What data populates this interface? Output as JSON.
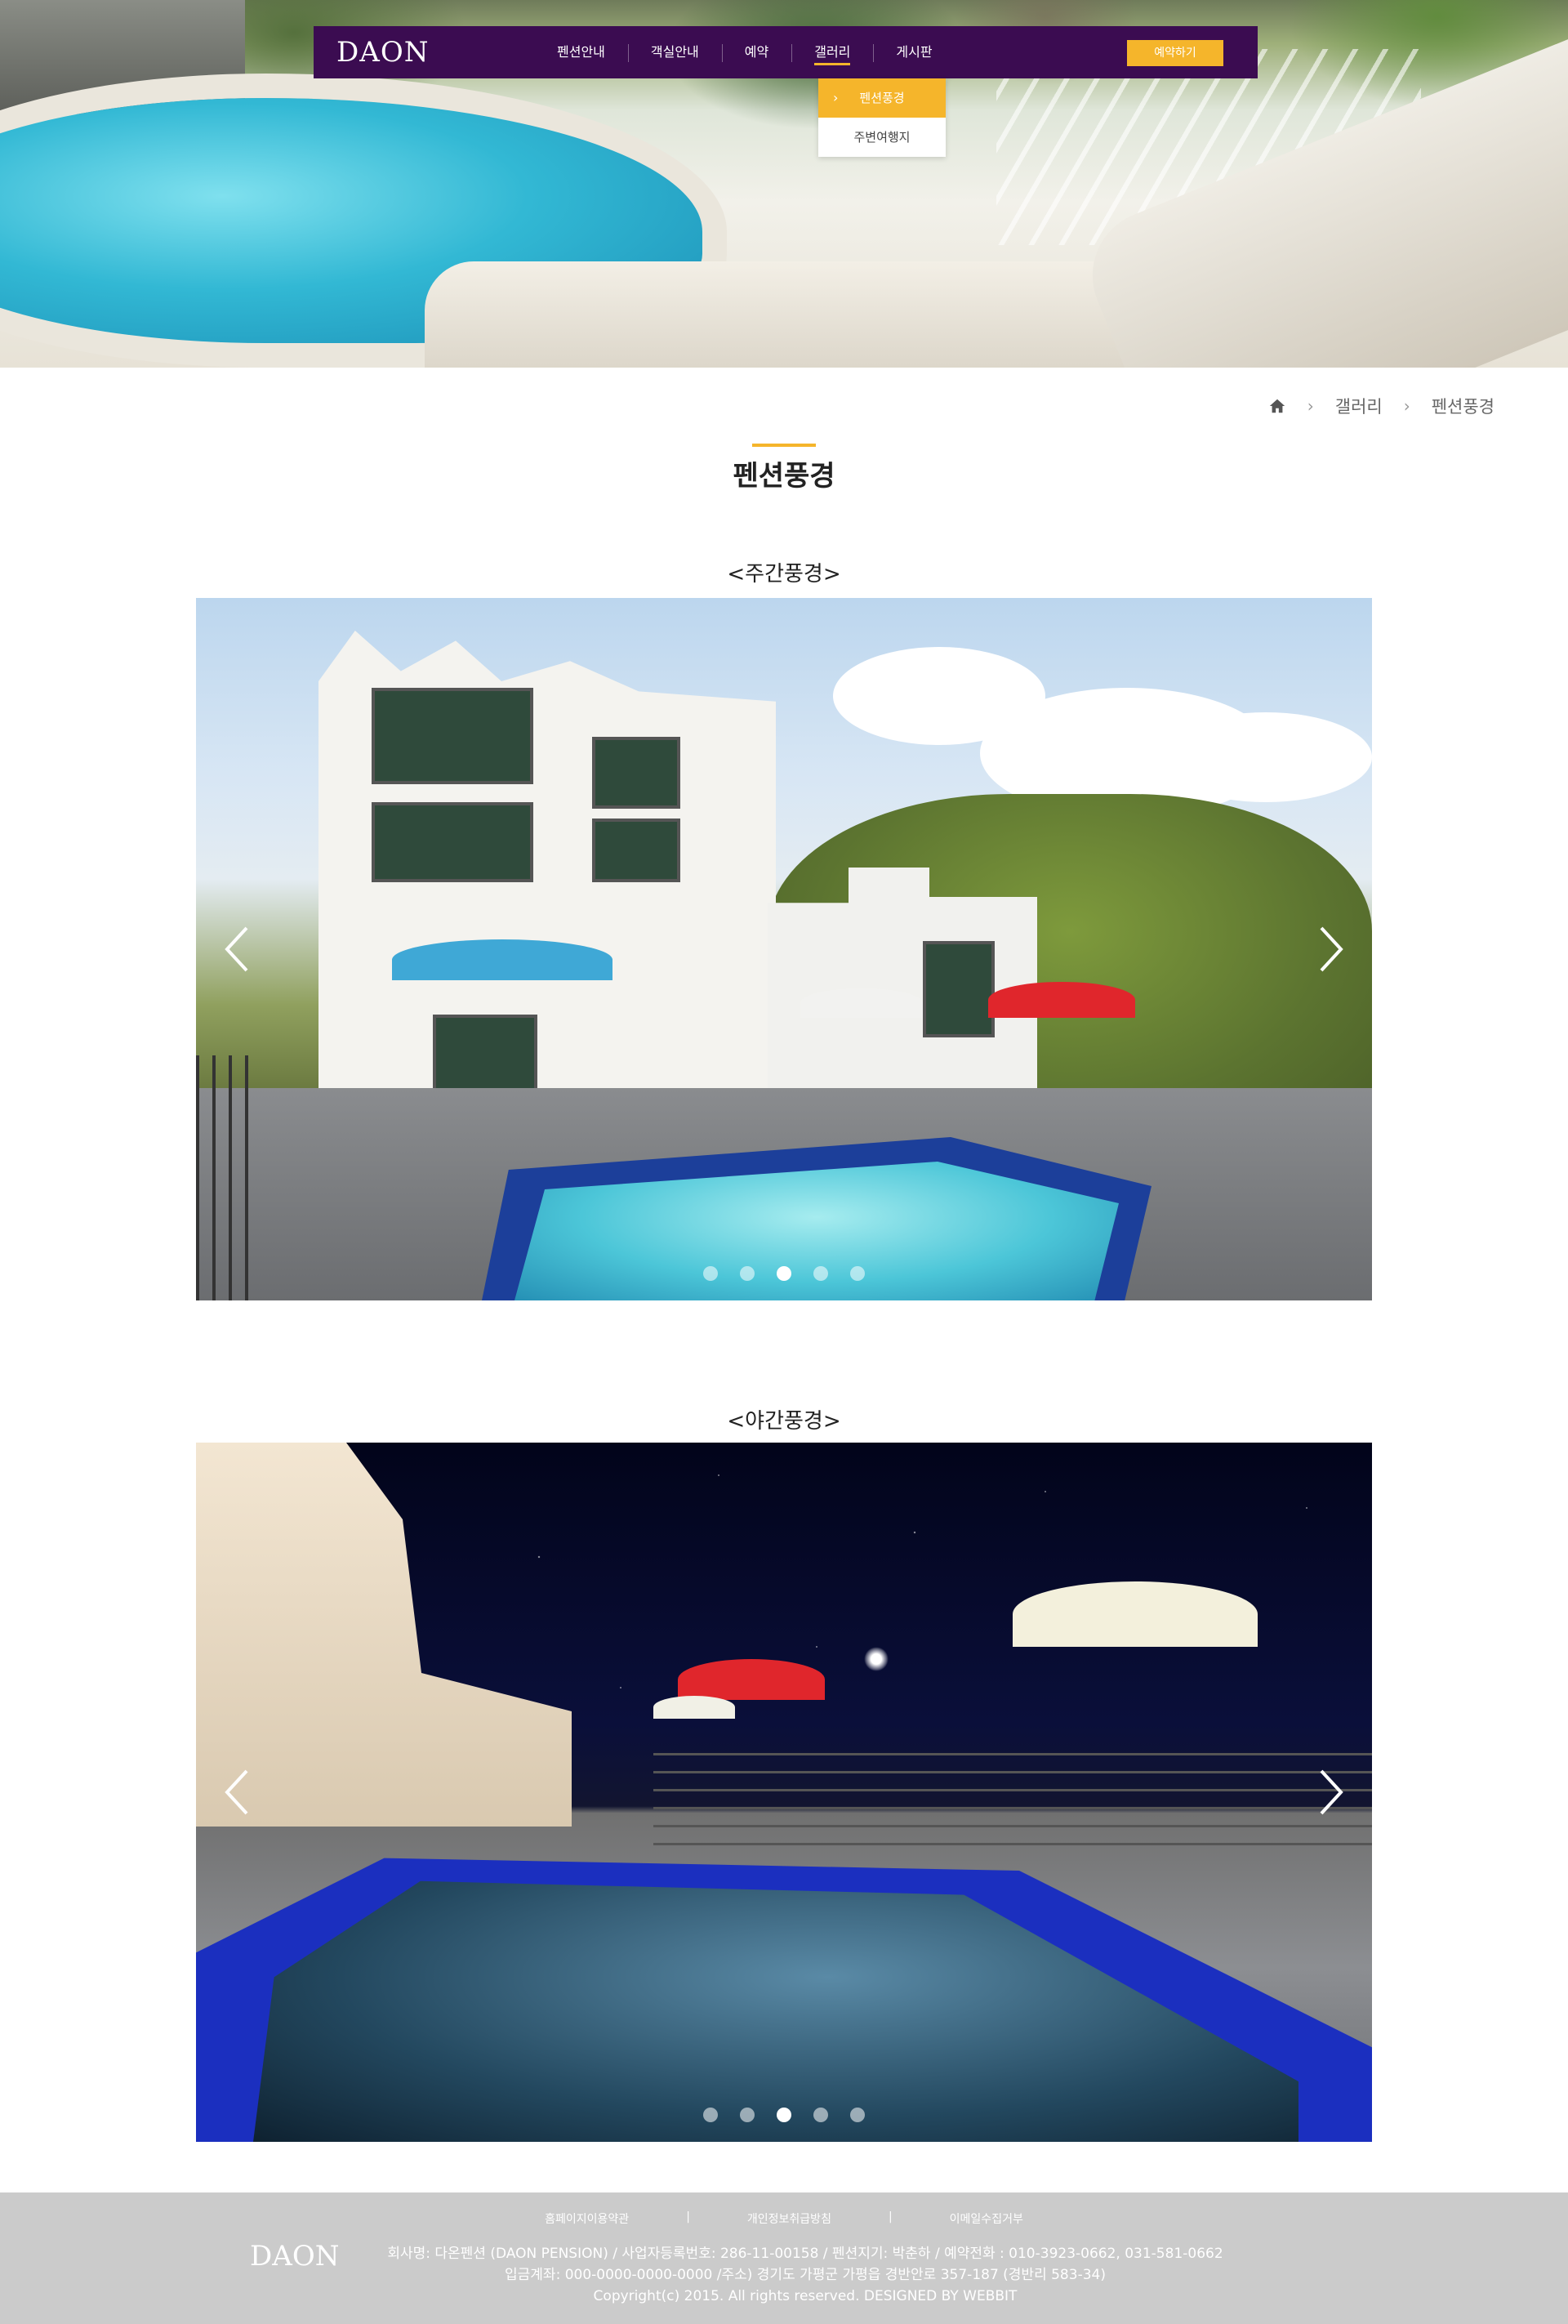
{
  "brand": {
    "logo": "DAON"
  },
  "nav": {
    "items": [
      {
        "label": "펜션안내"
      },
      {
        "label": "객실안내"
      },
      {
        "label": "예약"
      },
      {
        "label": "갤러리"
      },
      {
        "label": "게시판"
      }
    ],
    "active_index": 3,
    "reserve_label": "예약하기",
    "submenu": [
      {
        "label": "펜션풍경"
      },
      {
        "label": "주변여행지"
      }
    ],
    "accent_color": "#f5b52b",
    "bar_color": "#3b0c51"
  },
  "breadcrumb": {
    "home_icon": "home-icon",
    "items": [
      "갤러리",
      "펜션풍경"
    ]
  },
  "page_title": "펜션풍경",
  "sections": {
    "day": {
      "title": "<주간풍경>",
      "active_dot": 3,
      "dot_count": 5
    },
    "night": {
      "title": "<야간풍경>",
      "active_dot": 3,
      "dot_count": 5
    }
  },
  "footer": {
    "links": [
      "홈페이지이용약관",
      "개인정보취급방침",
      "이메일수집거부"
    ],
    "logo": "DAON",
    "info_lines": [
      "회사명: 다온펜션 (DAON PENSION) / 사업자등록번호: 286-11-00158 / 펜션지기: 박춘하 / 예약전화 : 010-3923-0662, 031-581-0662",
      "입금계좌: 000-0000-0000-0000 /주소) 경기도 가평군 가평읍 경반안로 357-187 (경반리 583-34)",
      "Copyright(c) 2015. All rights reserved. DESIGNED BY WEBBIT"
    ]
  }
}
